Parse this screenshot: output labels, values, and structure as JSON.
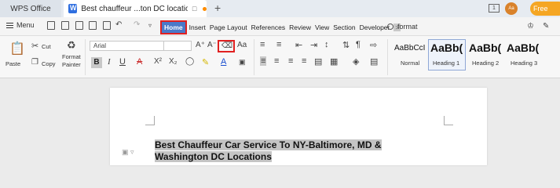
{
  "titlebar": {
    "app_tab": "WPS Office",
    "doc_tab_title": "Best chauffeur ...ton DC location",
    "new_tab_symbol": "+",
    "window_icon": "1",
    "avatar_initials": "Aa",
    "free_label": "Free"
  },
  "menubar": {
    "menu_label": "Menu",
    "tabs": [
      "Home",
      "Insert",
      "Page Layout",
      "References",
      "Review",
      "View",
      "Section",
      "Developer"
    ],
    "more_symbol": ">",
    "search_text": "format"
  },
  "ribbon": {
    "paste_label": "Paste",
    "cut_label": "Cut",
    "copy_label": "Copy",
    "format_painter_line1": "Format",
    "format_painter_line2": "Painter",
    "font_name": "Arial",
    "grow_font": "A⁺",
    "shrink_font": "A⁻",
    "bold": "B",
    "italic": "I",
    "underline": "U",
    "strike": "A",
    "superscript": "X²",
    "subscript": "X₂",
    "font_color": "A",
    "case": "Aa",
    "styles": [
      {
        "preview": "AaBbCcI",
        "name": "Normal"
      },
      {
        "preview": "AaBb(",
        "name": "Heading 1"
      },
      {
        "preview": "AaBb(",
        "name": "Heading 2"
      },
      {
        "preview": "AaBb(",
        "name": "Heading 3"
      }
    ]
  },
  "document": {
    "line1": "Best Chauffeur Car Service To NY-Baltimore, MD &",
    "line2": "Washington DC Locations"
  },
  "colors": {
    "accent": "#4a79c9",
    "highlight_box": "#e02020",
    "free_button": "#f5a623"
  }
}
